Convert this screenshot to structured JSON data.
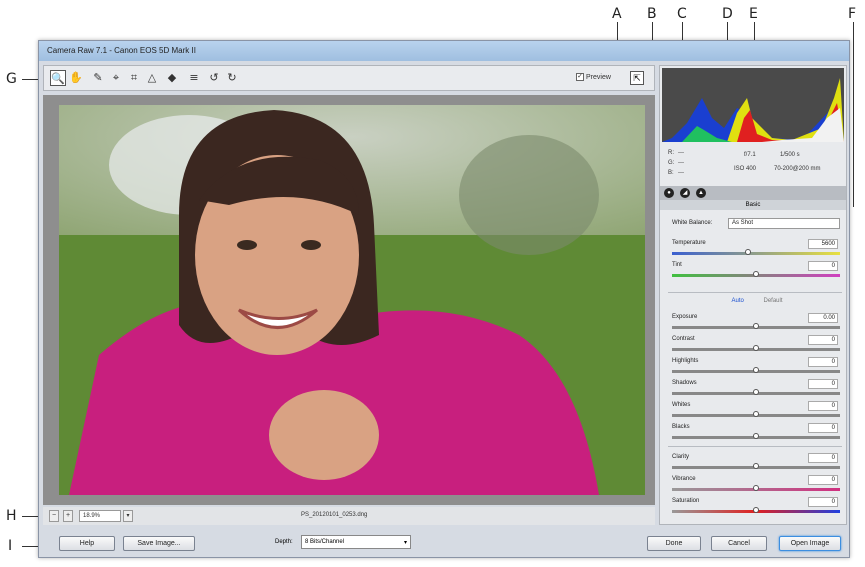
{
  "callouts": {
    "a": "A",
    "b": "B",
    "c": "C",
    "d": "D",
    "e": "E",
    "f": "F",
    "g": "G",
    "h": "H",
    "i": "I"
  },
  "window": {
    "title": "Camera Raw 7.1  -  Canon EOS 5D Mark II"
  },
  "toolbar": {
    "tools": [
      {
        "name": "zoom-tool-icon",
        "glyph": "🔍"
      },
      {
        "name": "hand-tool-icon",
        "glyph": "✋"
      },
      {
        "name": "white-balance-tool-icon",
        "glyph": "✎"
      },
      {
        "name": "color-sampler-tool-icon",
        "glyph": "⌖"
      },
      {
        "name": "crop-tool-icon",
        "glyph": "⌗"
      },
      {
        "name": "straighten-tool-icon",
        "glyph": "△"
      },
      {
        "name": "targeted-adjustment-tool-icon",
        "glyph": "◆"
      },
      {
        "name": "preferences-icon",
        "glyph": "≡"
      },
      {
        "name": "rotate-ccw-icon",
        "glyph": "↺"
      },
      {
        "name": "rotate-cw-icon",
        "glyph": "↻"
      }
    ],
    "preview_label": "Preview",
    "preview_checked": "✓",
    "fullscreen_glyph": "⇱"
  },
  "bottombar": {
    "zoom": "18.9%",
    "zoom_arrow": "▾",
    "filename": "PS_20120101_0253.dng",
    "zoom_minus": "−",
    "zoom_plus": "+"
  },
  "info": {
    "r": "R:",
    "g": "G:",
    "b": "B:",
    "rv": "---",
    "gv": "---",
    "bv": "---",
    "aperture": "f/7.1",
    "shutter": "1/500 s",
    "iso": "ISO 400",
    "lens": "70-200@200 mm"
  },
  "panel": {
    "header": "Basic",
    "white_balance_label": "White Balance:",
    "white_balance_value": "As Shot",
    "auto": "Auto",
    "default": "Default",
    "sliders": [
      {
        "label": "Temperature",
        "value": "5600",
        "level": 0.45
      },
      {
        "label": "Tint",
        "value": "0",
        "level": 0.5
      }
    ],
    "tone": [
      {
        "label": "Exposure",
        "value": "0.00",
        "level": 0.5
      },
      {
        "label": "Contrast",
        "value": "0",
        "level": 0.5
      },
      {
        "label": "Highlights",
        "value": "0",
        "level": 0.5
      },
      {
        "label": "Shadows",
        "value": "0",
        "level": 0.5
      },
      {
        "label": "Whites",
        "value": "0",
        "level": 0.5
      },
      {
        "label": "Blacks",
        "value": "0",
        "level": 0.5
      }
    ],
    "presence": [
      {
        "label": "Clarity",
        "value": "0",
        "level": 0.5
      },
      {
        "label": "Vibrance",
        "value": "0",
        "level": 0.5
      },
      {
        "label": "Saturation",
        "value": "0",
        "level": 0.5
      }
    ]
  },
  "footer": {
    "help": "Help",
    "save": "Save Image...",
    "depth_label": "Depth:",
    "depth_value": "8 Bits/Channel",
    "depth_arrow": "▾",
    "done": "Done",
    "cancel": "Cancel",
    "open": "Open Image"
  }
}
